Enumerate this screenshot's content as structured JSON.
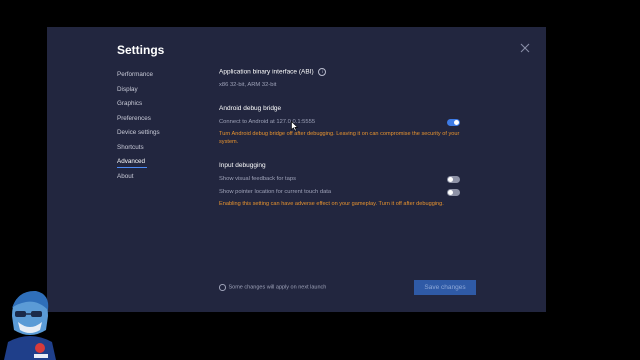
{
  "window": {
    "title": "Settings"
  },
  "sidebar": {
    "items": [
      {
        "label": "Performance"
      },
      {
        "label": "Display"
      },
      {
        "label": "Graphics"
      },
      {
        "label": "Preferences"
      },
      {
        "label": "Device settings"
      },
      {
        "label": "Shortcuts"
      },
      {
        "label": "Advanced",
        "active": true
      },
      {
        "label": "About"
      }
    ]
  },
  "abi": {
    "title": "Application binary interface (ABI)",
    "info_icon": "info-icon",
    "value": "x86 32-bit, ARM 32-bit"
  },
  "adb": {
    "title": "Android debug bridge",
    "label": "Connect to Android at 127.0.0.1:5555",
    "enabled": true,
    "warning": "Turn Android debug bridge off after debugging. Leaving it on can compromise the security of your system."
  },
  "input_debugging": {
    "title": "Input debugging",
    "visual_feedback_label": "Show visual feedback for taps",
    "visual_feedback_enabled": false,
    "pointer_location_label": "Show pointer location for current touch data",
    "pointer_location_enabled": false,
    "warning": "Enabling this setting can have adverse effect on your gameplay. Turn it off after  debugging."
  },
  "footer": {
    "note": "Some changes will apply on next launch",
    "save_label": "Save changes"
  },
  "colors": {
    "dialog_bg": "#22263f",
    "toggle_on": "#3d7be6",
    "toggle_off": "#8e92a6",
    "warning": "#e8932f",
    "button": "#2f5aa6"
  }
}
